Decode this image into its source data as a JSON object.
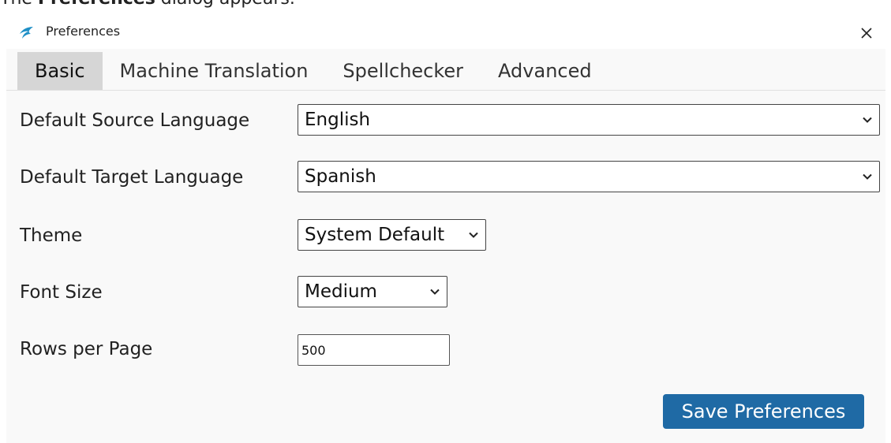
{
  "caption": {
    "prefix": "The ",
    "bold": "Preferences",
    "suffix": " dialog appears."
  },
  "window": {
    "title": "Preferences",
    "close_icon": "close-icon",
    "app_icon": "swallow-logo-icon"
  },
  "tabs": [
    {
      "label": "Basic",
      "active": true
    },
    {
      "label": "Machine Translation",
      "active": false
    },
    {
      "label": "Spellchecker",
      "active": false
    },
    {
      "label": "Advanced",
      "active": false
    }
  ],
  "form": {
    "source_language": {
      "label": "Default Source Language",
      "value": "English"
    },
    "target_language": {
      "label": "Default Target Language",
      "value": "Spanish"
    },
    "theme": {
      "label": "Theme",
      "value": "System Default"
    },
    "font_size": {
      "label": "Font Size",
      "value": "Medium"
    },
    "rows_per_page": {
      "label": "Rows per Page",
      "value": "500"
    }
  },
  "actions": {
    "save_label": "Save Preferences"
  },
  "colors": {
    "accent": "#1f6aa5",
    "active_tab": "#d6d6d6",
    "dialog_bg": "#f9f9f9",
    "logo": "#1e8fc6"
  }
}
